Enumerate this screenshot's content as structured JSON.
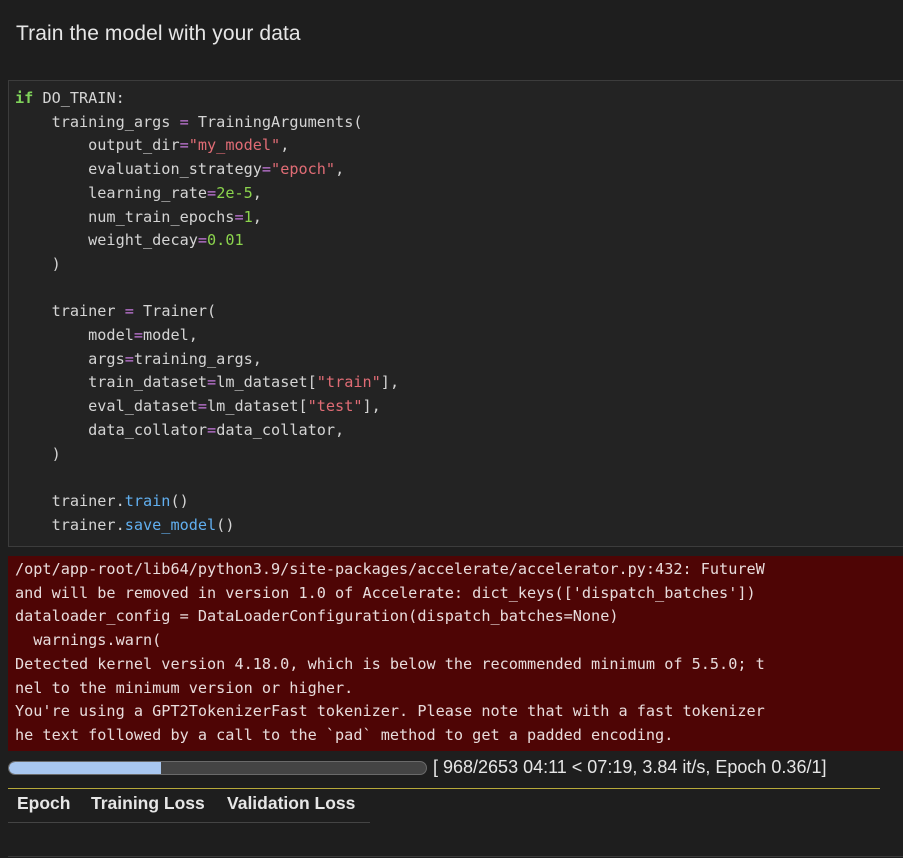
{
  "heading": "Train the model with your data",
  "code": {
    "l1_kw": "if",
    "l1_rest": " DO_TRAIN:",
    "l2_a": "    training_args ",
    "l2_op": "=",
    "l2_b": " TrainingArguments(",
    "l3_a": "        output_dir",
    "l3_op": "=",
    "l3_str": "\"my_model\"",
    "l3_b": ",",
    "l4_a": "        evaluation_strategy",
    "l4_op": "=",
    "l4_str": "\"epoch\"",
    "l4_b": ",",
    "l5_a": "        learning_rate",
    "l5_op": "=",
    "l5_num": "2e-5",
    "l5_b": ",",
    "l6_a": "        num_train_epochs",
    "l6_op": "=",
    "l6_num": "1",
    "l6_b": ",",
    "l7_a": "        weight_decay",
    "l7_op": "=",
    "l7_num": "0.01",
    "l8": "    )",
    "l10_a": "    trainer ",
    "l10_op": "=",
    "l10_b": " Trainer(",
    "l11_a": "        model",
    "l11_op": "=",
    "l11_b": "model,",
    "l12_a": "        args",
    "l12_op": "=",
    "l12_b": "training_args,",
    "l13_a": "        train_dataset",
    "l13_op": "=",
    "l13_b": "lm_dataset[",
    "l13_str": "\"train\"",
    "l13_c": "],",
    "l14_a": "        eval_dataset",
    "l14_op": "=",
    "l14_b": "lm_dataset[",
    "l14_str": "\"test\"",
    "l14_c": "],",
    "l15_a": "        data_collator",
    "l15_op": "=",
    "l15_b": "data_collator,",
    "l16": "    )",
    "l18_a": "    trainer.",
    "l18_fn": "train",
    "l18_b": "()",
    "l19_a": "    trainer.",
    "l19_fn": "save_model",
    "l19_b": "()"
  },
  "stderr_lines": [
    "/opt/app-root/lib64/python3.9/site-packages/accelerate/accelerator.py:432: FutureW",
    "and will be removed in version 1.0 of Accelerate: dict_keys(['dispatch_batches'])",
    "dataloader_config = DataLoaderConfiguration(dispatch_batches=None)",
    "  warnings.warn(",
    "Detected kernel version 4.18.0, which is below the recommended minimum of 5.5.0; t",
    "nel to the minimum version or higher.",
    "You're using a GPT2TokenizerFast tokenizer. Please note that with a fast tokenizer",
    "he text followed by a call to the `pad` method to get a padded encoding."
  ],
  "progress": {
    "fraction": 0.365,
    "text": "[ 968/2653 04:11 < 07:19, 3.84 it/s, Epoch 0.36/1]"
  },
  "metrics_table": {
    "headers": [
      "Epoch",
      "Training Loss",
      "Validation Loss"
    ]
  },
  "colors": {
    "keyword": "#7fd35a",
    "operator": "#c678dd",
    "string": "#e06c75",
    "number": "#8bd44d",
    "method": "#61afef",
    "stderr_bg": "#4e0505",
    "progress_fill": "#a9c7ef"
  }
}
